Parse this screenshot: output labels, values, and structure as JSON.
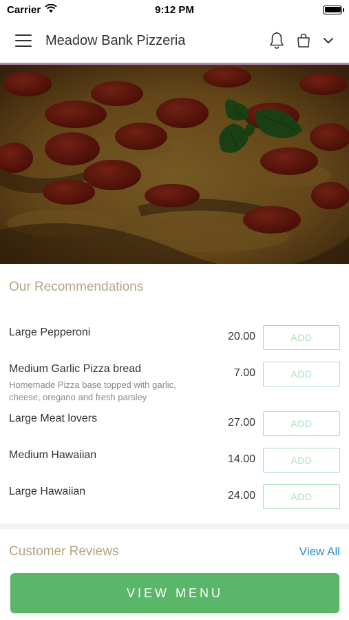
{
  "status_bar": {
    "carrier": "Carrier",
    "time": "9:12 PM"
  },
  "header": {
    "title": "Meadow Bank Pizzeria",
    "icons": [
      "menu-icon",
      "bell-icon",
      "shopping-bag-icon",
      "chevron-down-icon"
    ]
  },
  "hero": {
    "image": "pepperoni-pizza-with-basil"
  },
  "recommendations": {
    "title": "Our Recommendations",
    "items": [
      {
        "name": "Large Pepperoni",
        "description": "",
        "price": "20.00",
        "add_label": "ADD"
      },
      {
        "name": "Medium Garlic Pizza bread",
        "description": "Homemade Pizza base topped with garlic, cheese, oregano and fresh parsley",
        "price": "7.00",
        "add_label": "ADD"
      },
      {
        "name": "Large Meat lovers",
        "description": "",
        "price": "27.00",
        "add_label": "ADD"
      },
      {
        "name": "Medium Hawaiian",
        "description": "",
        "price": "14.00",
        "add_label": "ADD"
      },
      {
        "name": "Large Hawaiian",
        "description": "",
        "price": "24.00",
        "add_label": "ADD"
      }
    ]
  },
  "reviews": {
    "title": "Customer Reviews",
    "view_all": "View All"
  },
  "cta": {
    "label": "VIEW MENU"
  },
  "colors": {
    "section_title": "#b4a583",
    "add_button": "#a9dfb7",
    "link": "#2a8fc7",
    "cta": "#5ab668",
    "accent_line": "#b48ab0"
  }
}
